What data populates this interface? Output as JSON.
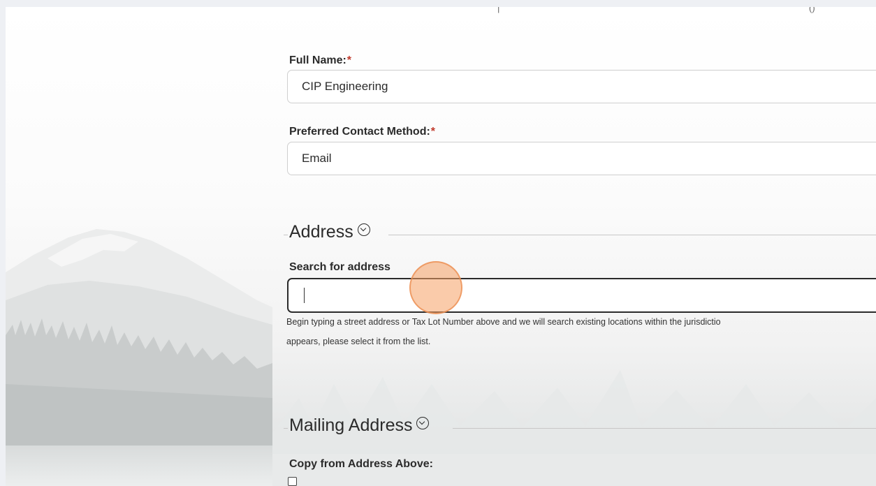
{
  "top_fragment": {
    "mark_a": "|",
    "mark_b": "()"
  },
  "form": {
    "full_name": {
      "label": "Full Name:",
      "required_mark": "*",
      "value": "CIP Engineering"
    },
    "contact_method": {
      "label": "Preferred Contact Method:",
      "required_mark": "*",
      "value": "Email"
    }
  },
  "address": {
    "heading": "Address",
    "search_label": "Search for address",
    "search_value": "",
    "help_line_1": "Begin typing a street address or Tax Lot Number above and we will search existing locations within the jurisdictio",
    "help_line_2": "appears, please select it from the list."
  },
  "mailing": {
    "heading": "Mailing Address",
    "copy_label": "Copy from Address Above:",
    "copy_checked": false
  },
  "icons": {
    "section_toggle": "chevron-circle-down-icon"
  }
}
